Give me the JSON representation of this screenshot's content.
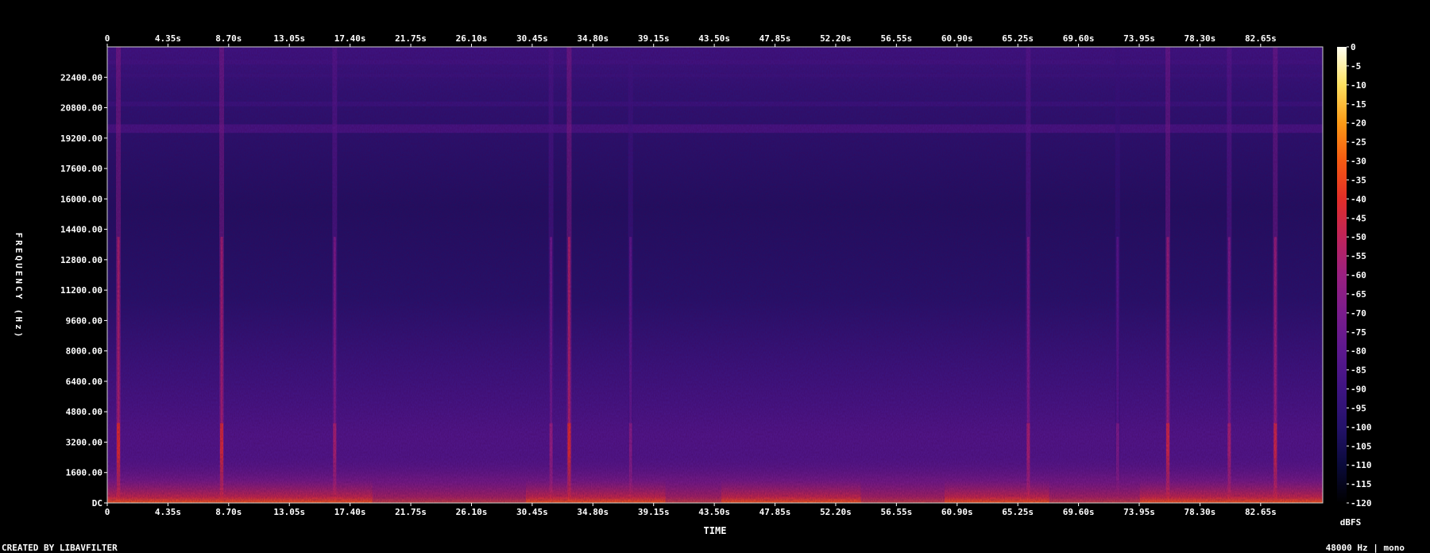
{
  "chart_data": {
    "type": "heatmap",
    "title": "",
    "xlabel": "TIME",
    "ylabel": "FREQUENCY (Hz)",
    "colorbar_label": "dBFS",
    "x_ticks": [
      "0",
      "4.35s",
      "8.70s",
      "13.05s",
      "17.40s",
      "21.75s",
      "26.10s",
      "30.45s",
      "34.80s",
      "39.15s",
      "43.50s",
      "47.85s",
      "52.20s",
      "56.55s",
      "60.90s",
      "65.25s",
      "69.60s",
      "73.95s",
      "78.30s",
      "82.65s"
    ],
    "x_tick_values": [
      0,
      4.35,
      8.7,
      13.05,
      17.4,
      21.75,
      26.1,
      30.45,
      34.8,
      39.15,
      43.5,
      47.85,
      52.2,
      56.55,
      60.9,
      65.25,
      69.6,
      73.95,
      78.3,
      82.65
    ],
    "xlim": [
      0,
      87.1
    ],
    "y_ticks": [
      "DC",
      "1600.00",
      "3200.00",
      "4800.00",
      "6400.00",
      "8000.00",
      "9600.00",
      "11200.00",
      "12800.00",
      "14400.00",
      "16000.00",
      "17600.00",
      "19200.00",
      "20800.00",
      "22400.00"
    ],
    "y_tick_values": [
      0,
      1600,
      3200,
      4800,
      6400,
      8000,
      9600,
      11200,
      12800,
      14400,
      16000,
      17600,
      19200,
      20800,
      22400
    ],
    "ylim": [
      0,
      24000
    ],
    "colorbar_ticks": [
      "0",
      "-5",
      "-10",
      "-15",
      "-20",
      "-25",
      "-30",
      "-35",
      "-40",
      "-45",
      "-50",
      "-55",
      "-60",
      "-65",
      "-70",
      "-75",
      "-80",
      "-85",
      "-90",
      "-95",
      "-100",
      "-105",
      "-110",
      "-115",
      "-120"
    ],
    "colorbar_values": [
      0,
      -5,
      -10,
      -15,
      -20,
      -25,
      -30,
      -35,
      -40,
      -45,
      -50,
      -55,
      -60,
      -65,
      -70,
      -75,
      -80,
      -85,
      -90,
      -95,
      -100,
      -105,
      -110,
      -115,
      -120
    ],
    "colorbar_range": [
      -120,
      0
    ],
    "colormap": [
      "#000000",
      "#0a0a3a",
      "#24126a",
      "#3e1482",
      "#5c188e",
      "#7a1c8c",
      "#9a2080",
      "#c0245a",
      "#e22e28",
      "#f55a12",
      "#fc9a16",
      "#fde060",
      "#fffff0"
    ],
    "background_level_db": -100,
    "high_band_rows": [
      {
        "f": 19700,
        "width": 450,
        "db": -85
      },
      {
        "f": 21000,
        "width": 250,
        "db": -91
      },
      {
        "f": 22500,
        "width": 200,
        "db": -92
      },
      {
        "f": 23200,
        "width": 250,
        "db": -89
      }
    ],
    "events": [
      {
        "t": 0.8,
        "db": -40
      },
      {
        "t": 8.2,
        "db": -42
      },
      {
        "t": 16.3,
        "db": -55
      },
      {
        "t": 31.8,
        "db": -60
      },
      {
        "t": 33.1,
        "db": -40
      },
      {
        "t": 37.5,
        "db": -65
      },
      {
        "t": 66.0,
        "db": -55
      },
      {
        "t": 72.4,
        "db": -68
      },
      {
        "t": 76.0,
        "db": -45
      },
      {
        "t": 80.4,
        "db": -55
      },
      {
        "t": 83.7,
        "db": -45
      }
    ],
    "quiet_segments": [
      [
        19.0,
        30.0
      ],
      [
        40.0,
        44.0
      ],
      [
        54.0,
        60.0
      ],
      [
        67.5,
        74.0
      ]
    ]
  },
  "footer": {
    "left": "CREATED BY LIBAVFILTER",
    "right": "48000 Hz | mono"
  }
}
